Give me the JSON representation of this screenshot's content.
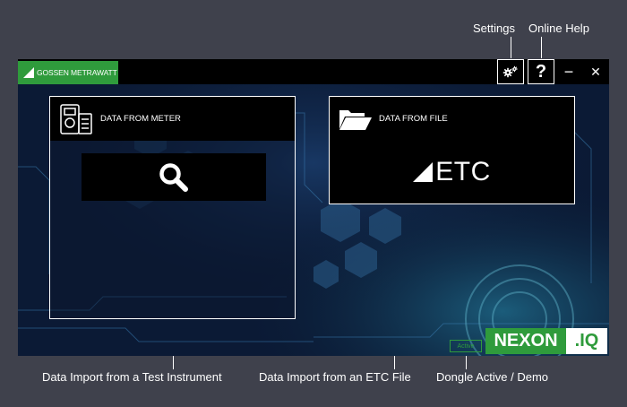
{
  "callouts": {
    "settings": "Settings",
    "online_help": "Online Help",
    "import_meter": "Data Import from a Test Instrument",
    "import_etc": "Data Import from an ETC File",
    "dongle": "Dongle Active / Demo"
  },
  "titlebar": {
    "brand": "GOSSEN METRAWATT",
    "help_symbol": "?",
    "minimize_symbol": "−",
    "close_symbol": "✕"
  },
  "meter_panel": {
    "title": "DATA FROM METER"
  },
  "file_panel": {
    "title": "DATA FROM FILE",
    "etc_label": "ETC"
  },
  "status": {
    "dongle_label": "Active"
  },
  "product_logo": {
    "left": "NEXON",
    "right": ".IQ"
  },
  "colors": {
    "brand_green": "#2f9b3c",
    "backdrop": "#3f414c",
    "app_background": "#0b1a35"
  }
}
